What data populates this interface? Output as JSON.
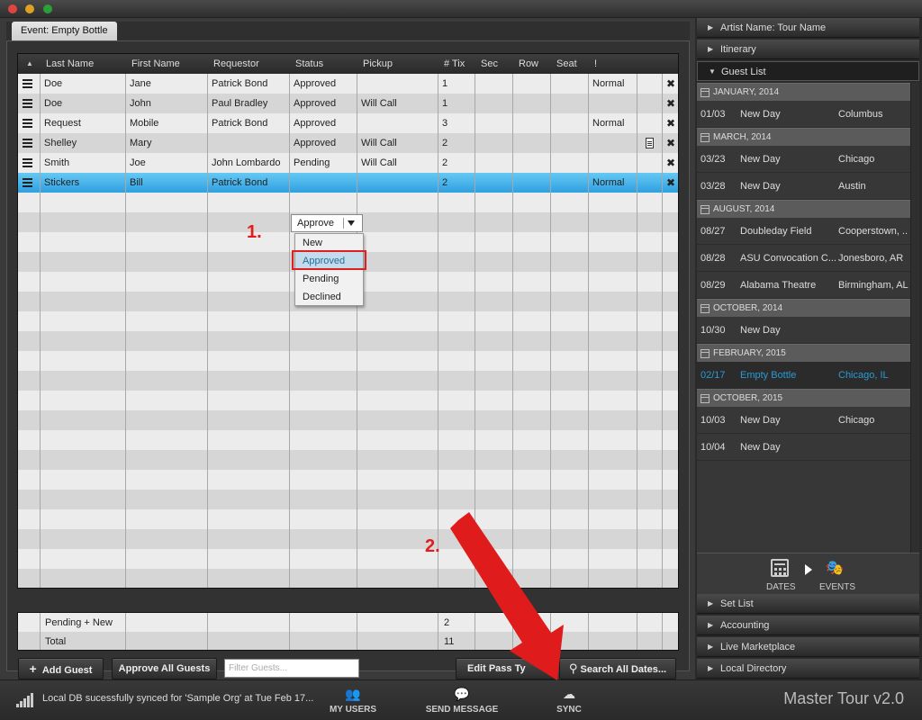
{
  "event_tab": "Event: Empty Bottle",
  "grid": {
    "headers": [
      "Last Name",
      "First Name",
      "Requestor",
      "Status",
      "Pickup",
      "# Tix",
      "Sec",
      "Row",
      "Seat",
      "!"
    ],
    "rows": [
      {
        "last": "Doe",
        "first": "Jane",
        "requestor": "Patrick Bond",
        "status": "Approved",
        "pickup": "",
        "tix": "1",
        "priority": "Normal",
        "note": false
      },
      {
        "last": "Doe",
        "first": "John",
        "requestor": "Paul Bradley",
        "status": "Approved",
        "pickup": "Will Call",
        "tix": "1",
        "priority": "",
        "note": false
      },
      {
        "last": "Request",
        "first": "Mobile",
        "requestor": "Patrick Bond",
        "status": "Approved",
        "pickup": "",
        "tix": "3",
        "priority": "Normal",
        "note": false
      },
      {
        "last": "Shelley",
        "first": "Mary",
        "requestor": "",
        "status": "Approved",
        "pickup": "Will Call",
        "tix": "2",
        "priority": "",
        "note": true
      },
      {
        "last": "Smith",
        "first": "Joe",
        "requestor": "John Lombardo",
        "status": "Pending",
        "pickup": "Will Call",
        "tix": "2",
        "priority": "",
        "note": false
      },
      {
        "last": "Stickers",
        "first": "Bill",
        "requestor": "Patrick Bond",
        "status": "",
        "pickup": "",
        "tix": "2",
        "priority": "Normal",
        "note": false
      }
    ],
    "status_dropdown": {
      "value": "Approve",
      "options": [
        "New",
        "Approved",
        "Pending",
        "Declined"
      ],
      "highlighted": "Approved"
    }
  },
  "summary": [
    {
      "label": "Pending + New",
      "tix": "2"
    },
    {
      "label": "Total",
      "tix": "11"
    }
  ],
  "toolbar": {
    "add_guest": "Add Guest",
    "approve_all": "Approve All Guests",
    "filter_placeholder": "Filter Guests...",
    "edit_pass": "Edit Pass Ty",
    "search_all": "Search All Dates..."
  },
  "annotations": {
    "step1": "1.",
    "step2": "2."
  },
  "right_panel": {
    "top_sections": [
      "Artist Name: Tour Name",
      "Itinerary",
      "Guest List"
    ],
    "months": [
      {
        "label": "JANUARY, 2014",
        "events": [
          {
            "date": "01/03",
            "venue": "New Day",
            "city": "Columbus"
          }
        ]
      },
      {
        "label": "MARCH, 2014",
        "events": [
          {
            "date": "03/23",
            "venue": "New Day",
            "city": "Chicago"
          },
          {
            "date": "03/28",
            "venue": "New Day",
            "city": "Austin"
          }
        ]
      },
      {
        "label": "AUGUST, 2014",
        "events": [
          {
            "date": "08/27",
            "venue": "Doubleday Field",
            "city": "Cooperstown, ..."
          },
          {
            "date": "08/28",
            "venue": "ASU Convocation C...",
            "city": "Jonesboro, AR"
          },
          {
            "date": "08/29",
            "venue": "Alabama Theatre",
            "city": "Birmingham, AL"
          }
        ]
      },
      {
        "label": "OCTOBER, 2014",
        "events": [
          {
            "date": "10/30",
            "venue": "New Day",
            "city": ""
          }
        ]
      },
      {
        "label": "FEBRUARY, 2015",
        "events": [
          {
            "date": "02/17",
            "venue": "Empty Bottle",
            "city": "Chicago, IL",
            "selected": true
          }
        ]
      },
      {
        "label": "OCTOBER, 2015",
        "events": [
          {
            "date": "10/03",
            "venue": "New Day",
            "city": "Chicago"
          },
          {
            "date": "10/04",
            "venue": "New Day",
            "city": ""
          }
        ]
      }
    ],
    "view_labels": {
      "dates": "DATES",
      "events": "EVENTS"
    },
    "bottom_sections": [
      "Set List",
      "Accounting",
      "Live Marketplace",
      "Local Directory"
    ]
  },
  "statusbar": {
    "message": "Local DB sucessfully synced for 'Sample Org' at Tue Feb 17...",
    "buttons": {
      "my_users": "MY USERS",
      "send_message": "SEND MESSAGE",
      "sync": "SYNC"
    },
    "brand": "Master Tour v2.0"
  },
  "colors": {
    "accent_blue": "#2b9ad6",
    "annotation_red": "#e21c1c",
    "selected_row": "#3aa8e8"
  }
}
